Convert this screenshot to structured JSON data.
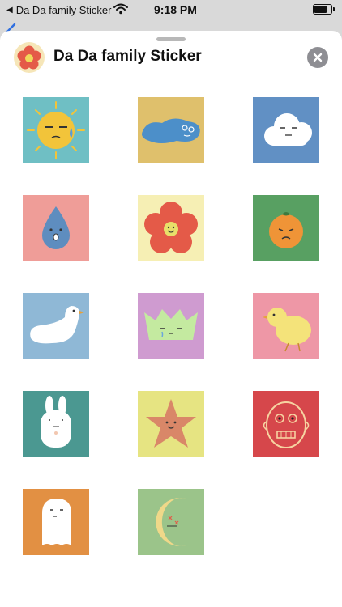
{
  "status_bar": {
    "back_label": "Da Da family Sticker",
    "time": "9:18 PM"
  },
  "sheet": {
    "title": "Da Da family Sticker",
    "icons": {
      "app": "flower-app-icon",
      "close": "close-icon",
      "back": "back-chevron-icon",
      "wifi": "wifi-icon",
      "battery": "battery-icon"
    },
    "stickers": [
      {
        "name": "sun",
        "bg": "#6fbfc4"
      },
      {
        "name": "puddle",
        "bg": "#dfc06c"
      },
      {
        "name": "cloud",
        "bg": "#6190c4"
      },
      {
        "name": "raindrop",
        "bg": "#ef9d98"
      },
      {
        "name": "flower",
        "bg": "#f6efb4"
      },
      {
        "name": "orange",
        "bg": "#58a062"
      },
      {
        "name": "duck",
        "bg": "#8fb8d6"
      },
      {
        "name": "crown",
        "bg": "#cf9bd0"
      },
      {
        "name": "chick",
        "bg": "#ee97a6"
      },
      {
        "name": "bunny",
        "bg": "#4b9891"
      },
      {
        "name": "starfish",
        "bg": "#e6e482"
      },
      {
        "name": "mask",
        "bg": "#d6474b"
      },
      {
        "name": "ghost",
        "bg": "#e29043"
      },
      {
        "name": "moon",
        "bg": "#9bc48a"
      }
    ]
  }
}
